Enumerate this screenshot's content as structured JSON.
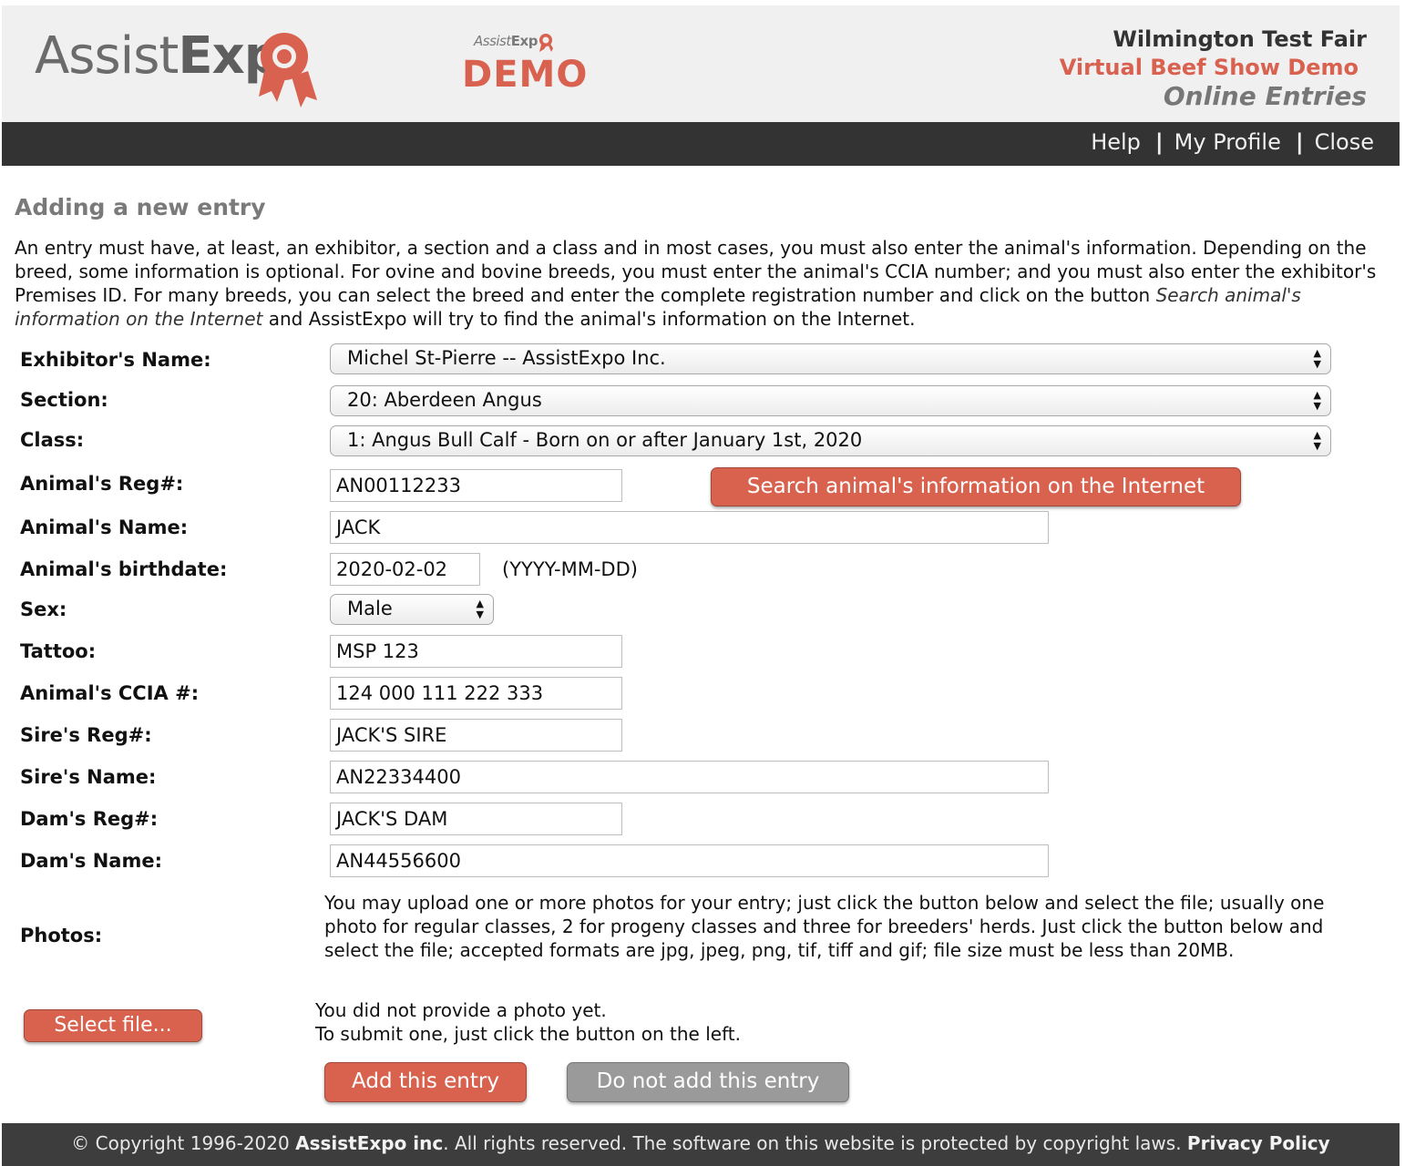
{
  "header": {
    "logo_text_light": "Assist",
    "logo_text_bold": "Exp",
    "demo_badge_light": "Assist",
    "demo_badge_bold": "Exp",
    "demo_word": "DEMO",
    "fair_name": "Wilmington Test Fair",
    "show_name": "Virtual Beef Show Demo",
    "section_name": "Online Entries",
    "brand_color": "#d8614f"
  },
  "nav": {
    "help": "Help",
    "my_profile": "My Profile",
    "close": "Close",
    "separator": "|"
  },
  "page": {
    "title": "Adding a new entry",
    "intro_before": "An entry must have, at least, an exhibitor, a section and a class and in most cases, you must also enter the animal's information. Depending on the breed, some information is optional. For ovine and bovine breeds, you must enter the animal's CCIA number; and you must also enter the exhibitor's Premises ID. For many breeds, you can select the breed and enter the complete registration number and click on the button ",
    "intro_italic": "Search animal's information on the Internet",
    "intro_after": " and AssistExpo will try to find the animal's information on the Internet."
  },
  "form": {
    "exhibitor": {
      "label": "Exhibitor's Name:",
      "value": "Michel St-Pierre -- AssistExpo Inc."
    },
    "section": {
      "label": "Section:",
      "value": "20: Aberdeen Angus"
    },
    "class": {
      "label": "Class:",
      "value": "1: Angus Bull Calf - Born on or after January 1st, 2020"
    },
    "reg": {
      "label": "Animal's Reg#:",
      "value": "AN00112233"
    },
    "search_button": "Search animal's information on the Internet",
    "name": {
      "label": "Animal's Name:",
      "value": "JACK"
    },
    "birthdate": {
      "label": "Animal's birthdate:",
      "value": "2020-02-02",
      "hint": "(YYYY-MM-DD)"
    },
    "sex": {
      "label": "Sex:",
      "value": "Male"
    },
    "tattoo": {
      "label": "Tattoo:",
      "value": "MSP 123"
    },
    "ccia": {
      "label": "Animal's CCIA #:",
      "value": "124 000 111 222 333"
    },
    "sire_reg": {
      "label": "Sire's Reg#:",
      "value": "JACK'S SIRE"
    },
    "sire_name": {
      "label": "Sire's Name:",
      "value": "AN22334400"
    },
    "dam_reg": {
      "label": "Dam's Reg#:",
      "value": "JACK'S DAM"
    },
    "dam_name": {
      "label": "Dam's Name:",
      "value": "AN44556600"
    },
    "photos": {
      "label": "Photos:",
      "instructions": "You may upload one or more photos for your entry; just click the button below and select the file; usually one photo for regular classes, 2 for progeny classes and three for breeders' herds. Just click the button below and select the file; accepted formats are jpg, jpeg, png, tif, tiff and gif; file size must be less than 20MB.",
      "select_button": "Select file...",
      "status_line1": "You did not provide a photo yet.",
      "status_line2": "To submit one, just click the button on the left."
    },
    "add_button": "Add this entry",
    "cancel_button": "Do not add this entry"
  },
  "footer": {
    "copyright": "© Copyright 1996-2020 ",
    "company": "AssistExpo inc",
    "rights": ".  All rights reserved.  The software on this website is protected by copyright laws.  ",
    "privacy": "Privacy Policy"
  }
}
